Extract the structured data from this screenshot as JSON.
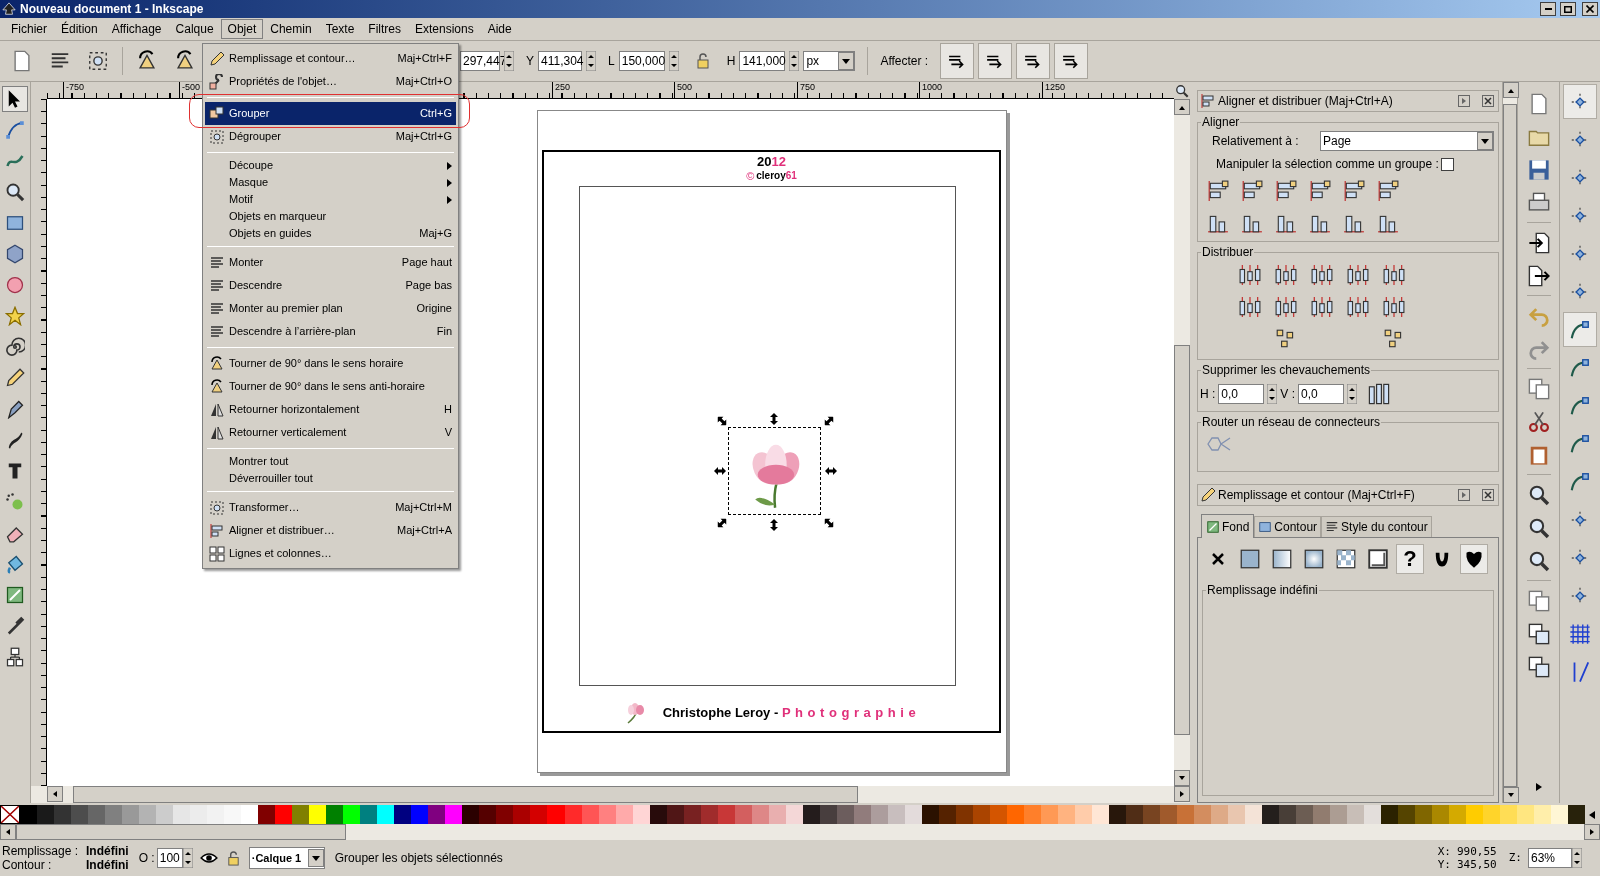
{
  "window": {
    "title": "Nouveau document 1 - Inkscape"
  },
  "menubar": [
    {
      "label": "Fichier",
      "selected": false
    },
    {
      "label": "Édition",
      "selected": false
    },
    {
      "label": "Affichage",
      "selected": false
    },
    {
      "label": "Calque",
      "selected": false
    },
    {
      "label": "Objet",
      "selected": true
    },
    {
      "label": "Chemin",
      "selected": false
    },
    {
      "label": "Texte",
      "selected": false
    },
    {
      "label": "Filtres",
      "selected": false
    },
    {
      "label": "Extensions",
      "selected": false
    },
    {
      "label": "Aide",
      "selected": false
    }
  ],
  "object_menu": {
    "sections": [
      {
        "items": [
          {
            "label": "Remplissage et contour…",
            "shortcut": "Maj+Ctrl+F",
            "icon": true,
            "submenu": false,
            "selected": false
          },
          {
            "label": "Propriétés de l'objet…",
            "shortcut": "Maj+Ctrl+O",
            "icon": true,
            "submenu": false,
            "selected": false
          }
        ]
      },
      {
        "items": [
          {
            "label": "Grouper",
            "shortcut": "Ctrl+G",
            "icon": true,
            "submenu": false,
            "selected": true
          },
          {
            "label": "Dégrouper",
            "shortcut": "Maj+Ctrl+G",
            "icon": true,
            "submenu": false,
            "selected": false
          }
        ]
      },
      {
        "items": [
          {
            "label": "Découpe",
            "icon": false,
            "submenu": true,
            "selected": false
          },
          {
            "label": "Masque",
            "icon": false,
            "submenu": true,
            "selected": false
          },
          {
            "label": "Motif",
            "icon": false,
            "submenu": true,
            "selected": false
          },
          {
            "label": "Objets en marqueur",
            "icon": false,
            "submenu": false,
            "selected": false
          },
          {
            "label": "Objets en guides",
            "shortcut": "Maj+G",
            "icon": false,
            "submenu": false,
            "selected": false
          }
        ]
      },
      {
        "items": [
          {
            "label": "Monter",
            "shortcut": "Page haut",
            "icon": true,
            "submenu": false,
            "selected": false
          },
          {
            "label": "Descendre",
            "shortcut": "Page bas",
            "icon": true,
            "submenu": false,
            "selected": false
          },
          {
            "label": "Monter au premier plan",
            "shortcut": "Origine",
            "icon": true,
            "submenu": false,
            "selected": false
          },
          {
            "label": "Descendre à l’arrière-plan",
            "shortcut": "Fin",
            "icon": true,
            "submenu": false,
            "selected": false
          }
        ]
      },
      {
        "items": [
          {
            "label": "Tourner de 90° dans le sens horaire",
            "icon": true,
            "submenu": false,
            "selected": false
          },
          {
            "label": "Tourner de 90° dans le sens anti-horaire",
            "icon": true,
            "submenu": false,
            "selected": false
          },
          {
            "label": "Retourner horizontalement",
            "shortcut": "H",
            "icon": true,
            "submenu": false,
            "selected": false
          },
          {
            "label": "Retourner verticalement",
            "shortcut": "V",
            "icon": true,
            "submenu": false,
            "selected": false
          }
        ]
      },
      {
        "items": [
          {
            "label": "Montrer tout",
            "icon": false,
            "submenu": false,
            "selected": false
          },
          {
            "label": "Déverrouiller tout",
            "icon": false,
            "submenu": false,
            "selected": false
          }
        ]
      },
      {
        "items": [
          {
            "label": "Transformer…",
            "shortcut": "Maj+Ctrl+M",
            "icon": true,
            "submenu": false,
            "selected": false
          },
          {
            "label": "Aligner et distribuer…",
            "shortcut": "Maj+Ctrl+A",
            "icon": true,
            "submenu": false,
            "selected": false
          },
          {
            "label": "Lignes et colonnes…",
            "icon": true,
            "submenu": false,
            "selected": false
          }
        ]
      }
    ]
  },
  "toolbar": {
    "x_value": "297,447",
    "y_label": "Y",
    "y_value": "411,304",
    "l_label": "L",
    "l_value": "150,000",
    "h_label": "H",
    "h_value": "141,000",
    "unit": "px",
    "affect_label": "Affecter :",
    "affect_toggles": [
      {
        "selected": true
      },
      {
        "selected": true
      },
      {
        "selected": true
      },
      {
        "selected": true
      }
    ]
  },
  "ruler_labels": [
    "-750",
    "-500",
    "250",
    "500",
    "750",
    "1000",
    "1250"
  ],
  "toolbox": [
    {
      "selected": true
    },
    {
      "selected": false
    },
    {
      "selected": false
    },
    {
      "selected": false
    },
    {
      "selected": false
    },
    {
      "selected": false
    },
    {
      "selected": false
    },
    {
      "selected": false
    },
    {
      "selected": false
    },
    {
      "selected": false
    },
    {
      "selected": false
    },
    {
      "selected": false
    },
    {
      "selected": false
    },
    {
      "selected": false
    },
    {
      "selected": false
    },
    {
      "selected": false
    },
    {
      "selected": false
    },
    {
      "selected": false
    },
    {
      "selected": false
    }
  ],
  "canvas": {
    "year": [
      {
        "text": "20",
        "accent": false
      },
      {
        "text": "12",
        "accent": true
      }
    ],
    "credit_mark": "©",
    "credit": [
      {
        "text": "cleroy",
        "accent": false
      },
      {
        "text": "61",
        "accent": true
      }
    ],
    "footer": [
      {
        "text": "Christophe Leroy - ",
        "accent": false
      },
      {
        "text": "Photographie",
        "accent": true
      }
    ]
  },
  "align_panel": {
    "title": "Aligner et distribuer (Maj+Ctrl+A)",
    "align_section": "Aligner",
    "relative_label": "Relativement à :",
    "relative_value": "Page",
    "group_label": "Manipuler la sélection comme un groupe :",
    "group_checked": false,
    "distribute_section": "Distribuer",
    "overlap_section": "Supprimer les chevauchements",
    "h_label": "H :",
    "h_value": "0,0",
    "v_label": "V :",
    "v_value": "0,0",
    "connector_section": "Router un réseau de connecteurs"
  },
  "fill_panel": {
    "title": "Remplissage et contour (Maj+Ctrl+F)",
    "tabs": [
      {
        "label": "Fond",
        "selected": true
      },
      {
        "label": "Contour",
        "selected": false
      },
      {
        "label": "Style du contour",
        "selected": false
      }
    ],
    "paint_modes": [
      {
        "kind": "none",
        "selected": false
      },
      {
        "kind": "flat",
        "selected": false
      },
      {
        "kind": "linear",
        "selected": false
      },
      {
        "kind": "radial",
        "selected": false
      },
      {
        "kind": "pattern",
        "selected": false
      },
      {
        "kind": "swatch",
        "selected": false
      },
      {
        "kind": "unset",
        "symbol": "?",
        "selected": true
      },
      {
        "kind": "evenodd",
        "selected": false
      },
      {
        "kind": "nonzero",
        "selected": true
      }
    ],
    "frame_label": "Remplissage indéfini"
  },
  "snap_bar": [
    {
      "selected": true
    },
    {
      "selected": false
    },
    {
      "selected": false
    },
    {
      "selected": false
    },
    {
      "selected": false
    },
    {
      "selected": false
    },
    {
      "selected": true
    },
    {
      "selected": false
    },
    {
      "selected": false
    },
    {
      "selected": false
    },
    {
      "selected": false
    },
    {
      "selected": false
    },
    {
      "selected": false
    },
    {
      "selected": false
    },
    {
      "selected": false
    },
    {
      "selected": false
    }
  ],
  "palette": [
    {
      "color": "#000000"
    },
    {
      "color": "#1a1a1a"
    },
    {
      "color": "#333333"
    },
    {
      "color": "#4d4d4d"
    },
    {
      "color": "#666666"
    },
    {
      "color": "#808080"
    },
    {
      "color": "#999999"
    },
    {
      "color": "#b3b3b3"
    },
    {
      "color": "#cccccc"
    },
    {
      "color": "#e6e6e6"
    },
    {
      "color": "#ececec"
    },
    {
      "color": "#f2f2f2"
    },
    {
      "color": "#f8f8f8"
    },
    {
      "color": "#ffffff"
    },
    {
      "color": "#800000"
    },
    {
      "color": "#ff0000"
    },
    {
      "color": "#808000"
    },
    {
      "color": "#ffff00"
    },
    {
      "color": "#008000"
    },
    {
      "color": "#00ff00"
    },
    {
      "color": "#008080"
    },
    {
      "color": "#00ffff"
    },
    {
      "color": "#000080"
    },
    {
      "color": "#0000ff"
    },
    {
      "color": "#800080"
    },
    {
      "color": "#ff00ff"
    },
    {
      "color": "#2b0000"
    },
    {
      "color": "#550000"
    },
    {
      "color": "#800000"
    },
    {
      "color": "#aa0000"
    },
    {
      "color": "#d40000"
    },
    {
      "color": "#ff0000"
    },
    {
      "color": "#ff2a2a"
    },
    {
      "color": "#ff5555"
    },
    {
      "color": "#ff8080"
    },
    {
      "color": "#ffaaaa"
    },
    {
      "color": "#ffd5d5"
    },
    {
      "color": "#280b0b"
    },
    {
      "color": "#501616"
    },
    {
      "color": "#782121"
    },
    {
      "color": "#a02c2c"
    },
    {
      "color": "#c83737"
    },
    {
      "color": "#d35f5f"
    },
    {
      "color": "#de8787"
    },
    {
      "color": "#e9afaf"
    },
    {
      "color": "#f4d7d7"
    },
    {
      "color": "#241c1c"
    },
    {
      "color": "#483e3e"
    },
    {
      "color": "#6c5d5d"
    },
    {
      "color": "#917c7c"
    },
    {
      "color": "#ac9d9d"
    },
    {
      "color": "#c8bebe"
    },
    {
      "color": "#e3dbdb"
    },
    {
      "color": "#2b1100"
    },
    {
      "color": "#552200"
    },
    {
      "color": "#803300"
    },
    {
      "color": "#aa4400"
    },
    {
      "color": "#d45500"
    },
    {
      "color": "#ff6600"
    },
    {
      "color": "#ff7f2a"
    },
    {
      "color": "#ff9955"
    },
    {
      "color": "#ffb380"
    },
    {
      "color": "#ffccaa"
    },
    {
      "color": "#ffe6d5"
    },
    {
      "color": "#28170b"
    },
    {
      "color": "#502d16"
    },
    {
      "color": "#784421"
    },
    {
      "color": "#a05a2c"
    },
    {
      "color": "#c87137"
    },
    {
      "color": "#d38d5f"
    },
    {
      "color": "#deaa87"
    },
    {
      "color": "#e9c6af"
    },
    {
      "color": "#f4e3d7"
    },
    {
      "color": "#241f1c"
    },
    {
      "color": "#483e37"
    },
    {
      "color": "#6c5d53"
    },
    {
      "color": "#917c6f"
    },
    {
      "color": "#ac9d93"
    },
    {
      "color": "#c8beb7"
    },
    {
      "color": "#e3dedb"
    },
    {
      "color": "#2b2200"
    },
    {
      "color": "#554400"
    },
    {
      "color": "#806600"
    },
    {
      "color": "#aa8800"
    },
    {
      "color": "#d4aa00"
    },
    {
      "color": "#ffcc00"
    },
    {
      "color": "#ffd42a"
    },
    {
      "color": "#ffdd55"
    },
    {
      "color": "#ffe680"
    },
    {
      "color": "#ffeeaa"
    },
    {
      "color": "#fff6d5"
    },
    {
      "color": "#28220b"
    }
  ],
  "status": {
    "fill_label": "Remplissage :",
    "fill_value": "Indéfini",
    "stroke_label": "Contour :",
    "stroke_value": "Indéfini",
    "opacity_label": "O :",
    "opacity_value": "100",
    "layer": "·Calque 1",
    "message": "Grouper les objets sélectionnés",
    "x_label": "X:",
    "x_value": "990,55",
    "y_label": "Y:",
    "y_value": "345,50",
    "zoom_label": "Z:",
    "zoom_value": "63%"
  }
}
